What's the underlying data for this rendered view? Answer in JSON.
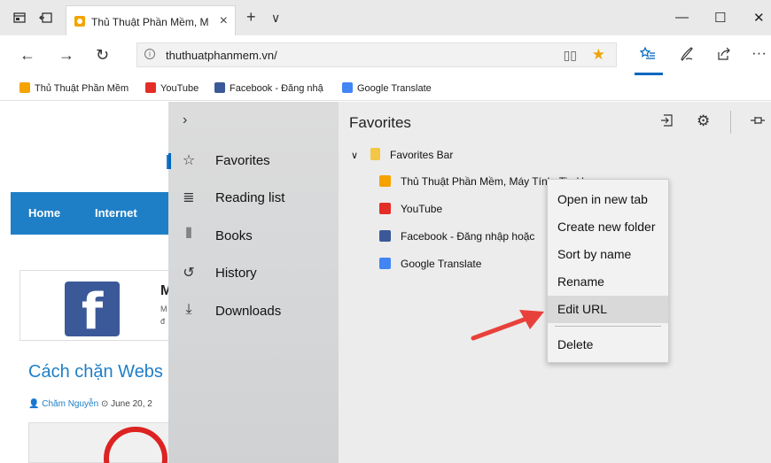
{
  "tab": {
    "title": "Thủ Thuật Phần Mềm, M",
    "new_tab": "+",
    "menu": "∨"
  },
  "window": {
    "minimize": "—",
    "maximize": "☐",
    "close": "✕"
  },
  "address": {
    "url": "thuthuatphanmem.vn/"
  },
  "bookmarks": [
    {
      "label": "Thủ Thuật Phần Mềm",
      "color": "#f4a300"
    },
    {
      "label": "YouTube",
      "color": "#e52d27"
    },
    {
      "label": "Facebook - Đăng nhậ",
      "color": "#3b5998"
    },
    {
      "label": "Google Translate",
      "color": "#4285f4"
    }
  ],
  "site": {
    "nav": [
      "Home",
      "Internet"
    ],
    "fb_letter": "f",
    "card_letter": "M",
    "card_small1": "M",
    "card_small2": "đ",
    "article_title": "Cách chặn Webs",
    "author": "Chăm Nguyễn",
    "date": "June 20, 2"
  },
  "hub": {
    "items": [
      {
        "label": "Favorites",
        "icon": "☆"
      },
      {
        "label": "Reading list",
        "icon": "≣"
      },
      {
        "label": "Books",
        "icon": "⫴"
      },
      {
        "label": "History",
        "icon": "↺"
      },
      {
        "label": "Downloads",
        "icon": "⤓"
      }
    ]
  },
  "favorites": {
    "title": "Favorites",
    "folder": "Favorites Bar",
    "entries": [
      {
        "label": "Thủ Thuật Phần Mềm, Máy Tính, Tin Học",
        "color": "#f4a300"
      },
      {
        "label": "YouTube",
        "color": "#e52d27"
      },
      {
        "label": "Facebook - Đăng nhập hoặc",
        "color": "#3b5998"
      },
      {
        "label": "Google Translate",
        "color": "#4285f4"
      }
    ]
  },
  "context_menu": {
    "items": [
      "Open in new tab",
      "Create new folder",
      "Sort by name",
      "Rename",
      "Edit URL",
      "Delete"
    ],
    "highlighted": "Edit URL"
  },
  "colors": {
    "accent": "#0067c0",
    "arrow": "#e8413c",
    "site_blue": "#1f7fc6"
  }
}
